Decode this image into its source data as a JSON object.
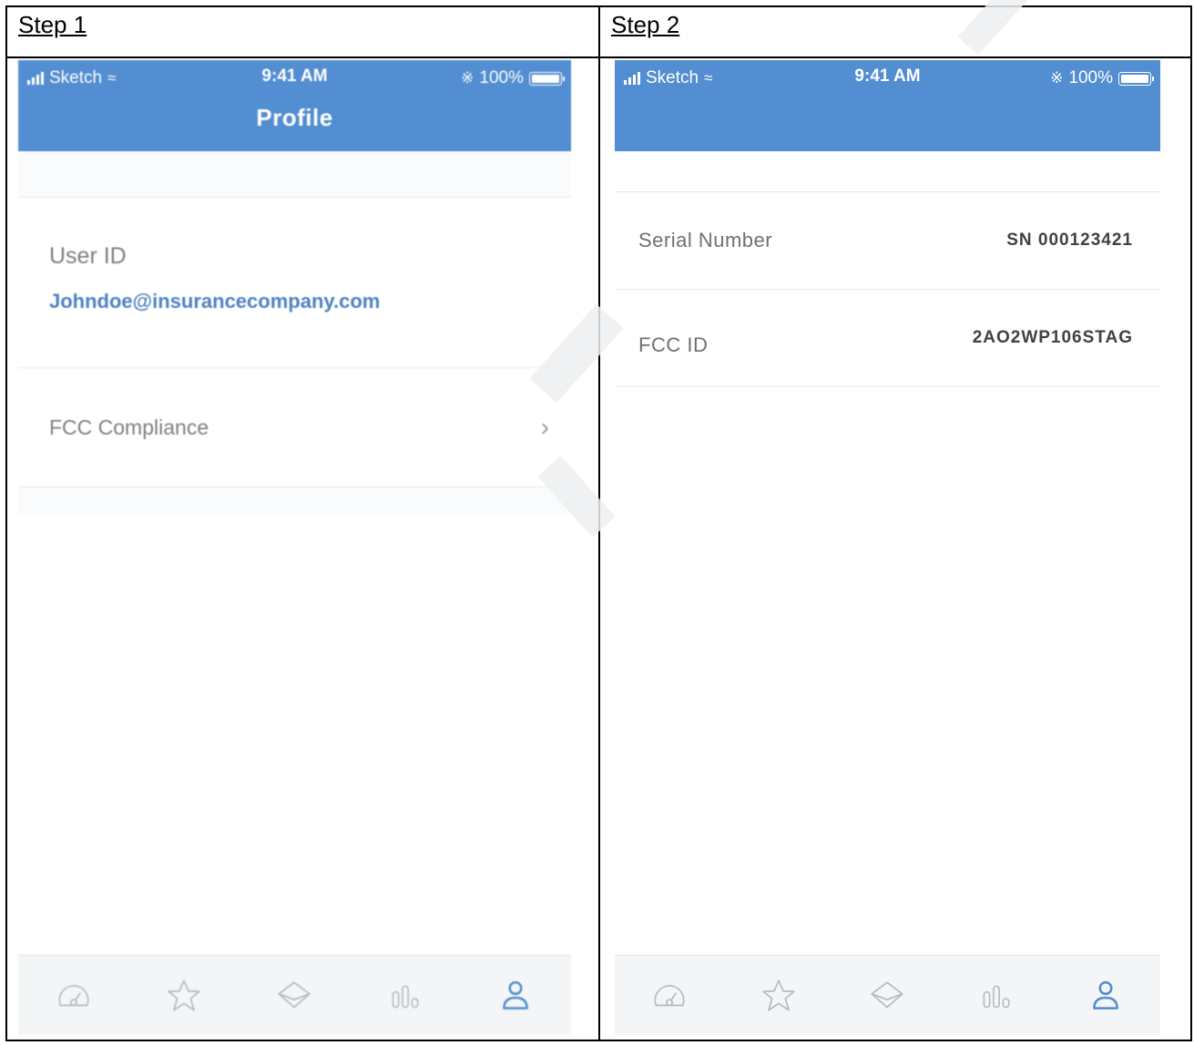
{
  "steps": [
    {
      "label": "Step 1"
    },
    {
      "label": "Step 2"
    }
  ],
  "status_bar": {
    "carrier": "Sketch",
    "time": "9:41 AM",
    "battery": "100%",
    "battery_level": 1.0
  },
  "step1": {
    "nav_title": "Profile",
    "user_id_label": "User ID",
    "user_id_value": "Johndoe@insurancecompany.com",
    "fcc_compliance_label": "FCC Compliance",
    "chevron": "›"
  },
  "step2": {
    "rows": [
      {
        "label": "Serial Number",
        "value": "SN 000123421"
      },
      {
        "label": "FCC ID",
        "value": "2AO2WP106STAG"
      }
    ]
  },
  "tabbar": {
    "items": [
      "speedometer-icon",
      "star-icon",
      "diamond-icon",
      "bars-icon",
      "profile-icon"
    ],
    "active_index": 4,
    "active_color": "#528ed1",
    "inactive_color": "#b5bac0"
  },
  "colors": {
    "nav_blue": "#528ed1",
    "link_blue": "#4e82c2"
  }
}
